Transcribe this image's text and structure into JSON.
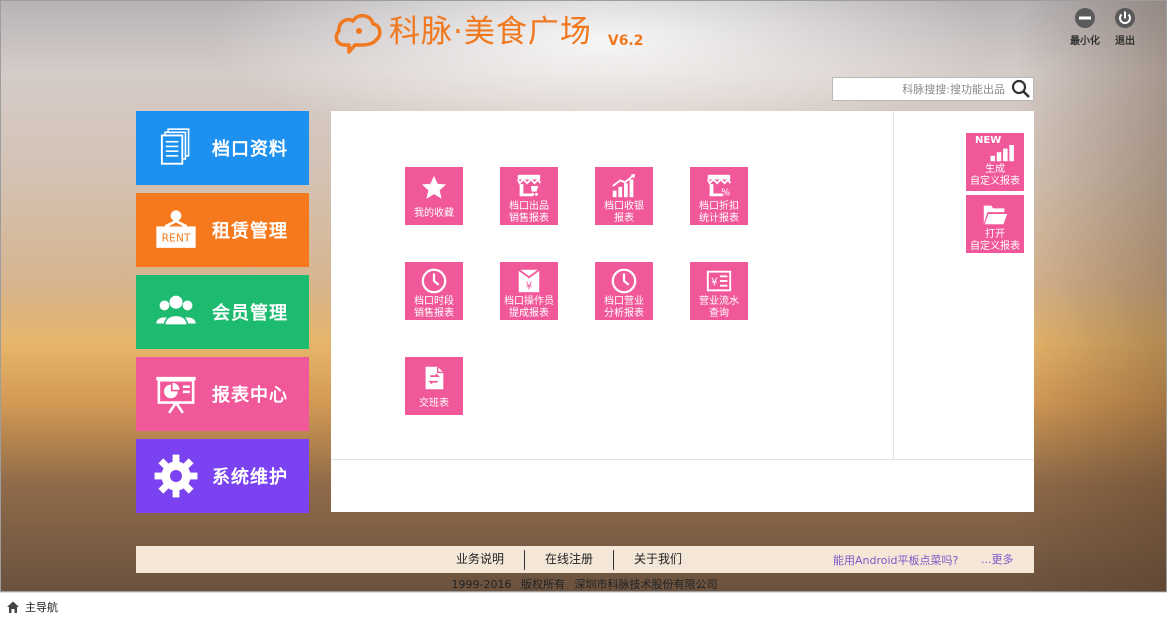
{
  "header": {
    "title": "科脉·美食广场",
    "version": "V6.2",
    "minimize_label": "最小化",
    "exit_label": "退出"
  },
  "search": {
    "placeholder": "科脉搜搜:搜功能出品"
  },
  "sidebar": {
    "items": [
      {
        "label": "档口资料",
        "color": "#1e90f0"
      },
      {
        "label": "租赁管理",
        "color": "#f7791e"
      },
      {
        "label": "会员管理",
        "color": "#1dbb6f"
      },
      {
        "label": "报表中心",
        "color": "#f1589a"
      },
      {
        "label": "系统维护",
        "color": "#7a42f0"
      }
    ]
  },
  "reports": {
    "items": [
      {
        "label": "我的收藏",
        "icon": "star-icon"
      },
      {
        "label": "档口出品\n销售报表",
        "icon": "stall-cart-icon"
      },
      {
        "label": "档口收银\n报表",
        "icon": "bar-chart-up-icon"
      },
      {
        "label": "档口折扣\n统计报表",
        "icon": "stall-discount-icon"
      },
      {
        "label": "档口时段\n销售报表",
        "icon": "clock-icon"
      },
      {
        "label": "档口操作员\n提成报表",
        "icon": "yen-envelope-icon"
      },
      {
        "label": "档口营业\n分析报表",
        "icon": "clock-icon"
      },
      {
        "label": "营业流水\n查询",
        "icon": "yen-list-icon"
      },
      {
        "label": "交班表",
        "icon": "document-exchange-icon"
      }
    ],
    "custom": [
      {
        "label": "生成\n自定义报表",
        "badge": "NEW",
        "icon": "signal-bars-icon"
      },
      {
        "label": "打开\n自定义报表",
        "icon": "folder-open-icon"
      }
    ]
  },
  "footer": {
    "links": [
      "业务说明",
      "在线注册",
      "关于我们"
    ],
    "question": "能用Android平板点菜吗?",
    "more": "...更多",
    "copyright_years": "1999-2016",
    "copyright_rights": "版权所有",
    "copyright_company": "深圳市科脉技术股份有限公司"
  },
  "statusbar": {
    "nav_label": "主导航"
  },
  "colors": {
    "accent": "#f0781e",
    "report_tile": "#f1589a",
    "link": "#7b58c9"
  }
}
